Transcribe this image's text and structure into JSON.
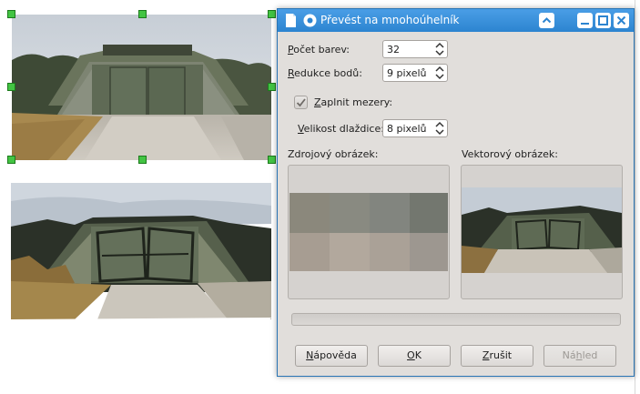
{
  "dialog": {
    "title": "Převést na mnohoúhelník",
    "colors": {
      "titlebar": "#2c84d0",
      "dialog_bg": "#e1dedb",
      "handle": "#43c443"
    },
    "fields": {
      "colors_label_key": "P",
      "colors_label_rest": "očet barev:",
      "colors_value": "32",
      "points_label_key": "R",
      "points_label_rest": "edukce bodů:",
      "points_value": "9 pixelů",
      "fill_gaps_label_key": "Z",
      "fill_gaps_label_rest": "aplnit mezery:",
      "fill_gaps_checked": true,
      "tile_label_key": "V",
      "tile_label_rest": "elikost dlaždice:",
      "tile_value": "8 pixelů"
    },
    "previews": {
      "source_label": "Zdrojový obrázek:",
      "vector_label": "Vektorový obrázek:"
    },
    "buttons": {
      "help_key": "N",
      "help_rest": "ápověda",
      "ok_key": "O",
      "ok_rest": "K",
      "cancel_key": "Z",
      "cancel_rest": "rušit",
      "preview_pre": "Ná",
      "preview_key": "h",
      "preview_rest": "led"
    },
    "titlebar_icons": [
      "document-icon",
      "gear-icon",
      "rollup-chevron-icon",
      "minimize-icon",
      "maximize-icon",
      "close-icon"
    ]
  },
  "document": {
    "images": [
      "bunker-photo-original",
      "bunker-photo-vectorized"
    ]
  }
}
